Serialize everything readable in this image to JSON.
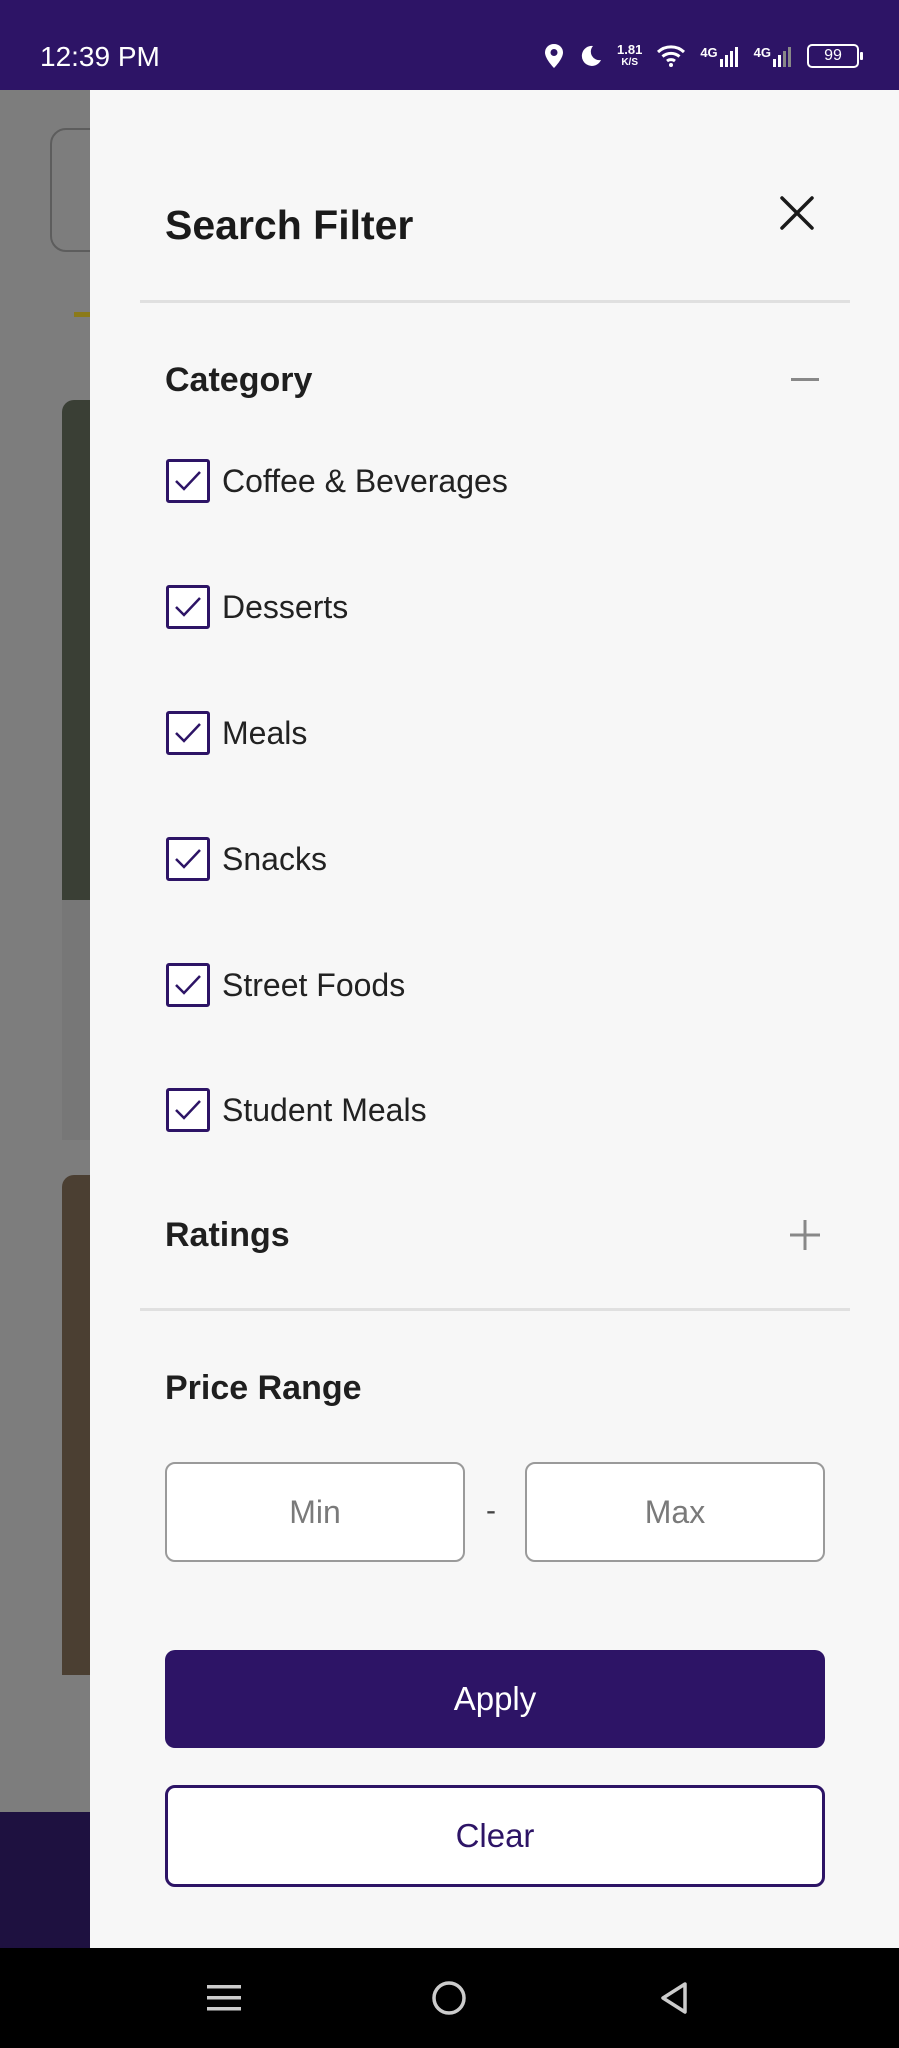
{
  "status_bar": {
    "time": "12:39 PM",
    "net_speed_value": "1.81",
    "net_speed_unit": "K/S",
    "network_1": "4G",
    "network_2": "4G",
    "battery": "99",
    "icons": [
      "location-icon",
      "moon-icon",
      "wifi-icon",
      "signal-icon",
      "signal-icon",
      "battery-icon"
    ]
  },
  "filter": {
    "title": "Search Filter",
    "category": {
      "label": "Category",
      "expanded": true,
      "items": [
        {
          "label": "Coffee & Beverages",
          "checked": true
        },
        {
          "label": "Desserts",
          "checked": true
        },
        {
          "label": "Meals",
          "checked": true
        },
        {
          "label": "Snacks",
          "checked": true
        },
        {
          "label": "Street Foods",
          "checked": true
        },
        {
          "label": "Student Meals",
          "checked": true
        }
      ]
    },
    "ratings": {
      "label": "Ratings",
      "expanded": false
    },
    "price_range": {
      "label": "Price Range",
      "min_placeholder": "Min",
      "max_placeholder": "Max",
      "separator": "-",
      "min_value": "",
      "max_value": ""
    },
    "apply_label": "Apply",
    "clear_label": "Clear"
  },
  "colors": {
    "primary": "#2d1466",
    "drawer_bg": "#f7f7f7",
    "overlay": "#7a7a7a"
  }
}
